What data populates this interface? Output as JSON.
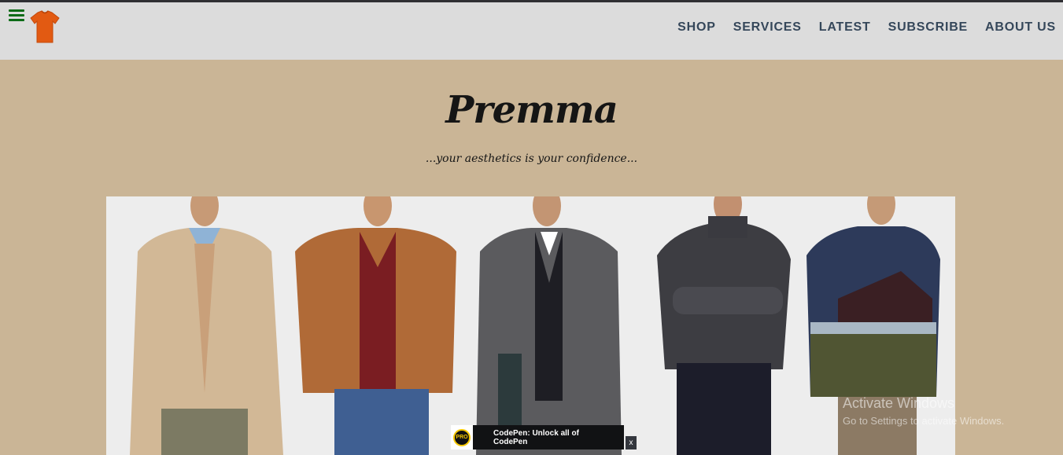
{
  "nav": {
    "menu_icon": "hamburger-menu-icon",
    "logo_icon": "orange-tshirt-icon",
    "links": [
      "SHOP",
      "SERVICES",
      "LATEST",
      "SUBSCRIBE",
      "ABOUT US"
    ]
  },
  "hero": {
    "brand": "Premma",
    "tagline": "...your aesthetics is your confidence..."
  },
  "watermark": {
    "line1": "Activate Windows",
    "line2": "Go to Settings to activate Windows."
  },
  "codepen_banner": {
    "badge": "PRO",
    "text": "CodePen: Unlock all of CodePen",
    "close": "x"
  },
  "colors": {
    "page_bg": "#cab596",
    "navbar_bg": "#dcdcdc",
    "nav_text": "#35475a",
    "menu_icon": "#0c6b16",
    "logo_shirt": "#e25a12"
  }
}
